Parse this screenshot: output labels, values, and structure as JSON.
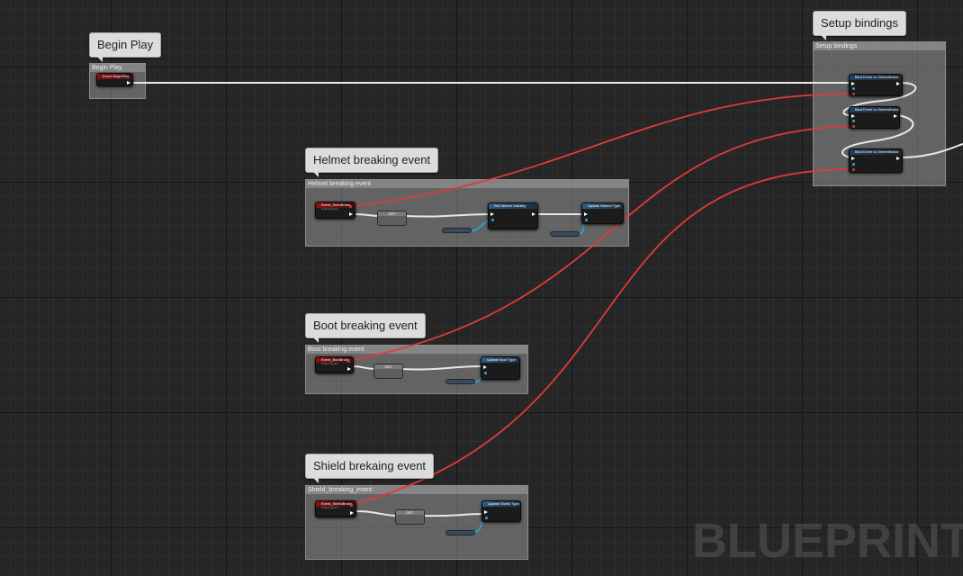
{
  "comments": {
    "begin_play": {
      "bubble": "Begin Play",
      "title": "Begin Play"
    },
    "setup_bindings": {
      "bubble": "Setup bindings",
      "title": "Setup bindings"
    },
    "helmet": {
      "bubble": "Helmet breaking event",
      "title": "Helmet breaking event"
    },
    "boot": {
      "bubble": "Boot breaking event",
      "title": "Boot breaking event"
    },
    "shield": {
      "bubble": "Shield brekaing event",
      "title": "Shield_breaking_event"
    }
  },
  "nodes": {
    "begin_play_event": "Event BeginPlay",
    "bind": [
      "Bind Event to OnItemBroke",
      "Bind Event to OnItemBroke",
      "Bind Event to OnItemBroke"
    ],
    "helmet_event": "Event_HelmBroke",
    "helmet_set": "Set Helmet Visibility",
    "helmet_update": "Update Helmet Type",
    "boot_event": "Event_BootBroke",
    "boot_update": "Update Boot Type",
    "shield_event": "Event_ShieldBroke",
    "shield_update": "Update Shield Type",
    "get_label": "GET",
    "event_sub": "Custom Event"
  },
  "watermark": "BLUEPRINT",
  "colors": {
    "exec_wire": "#ffffff",
    "delegate_wire": "#e03a3a",
    "data_wire": "#2aa6e0",
    "background": "#262626"
  }
}
